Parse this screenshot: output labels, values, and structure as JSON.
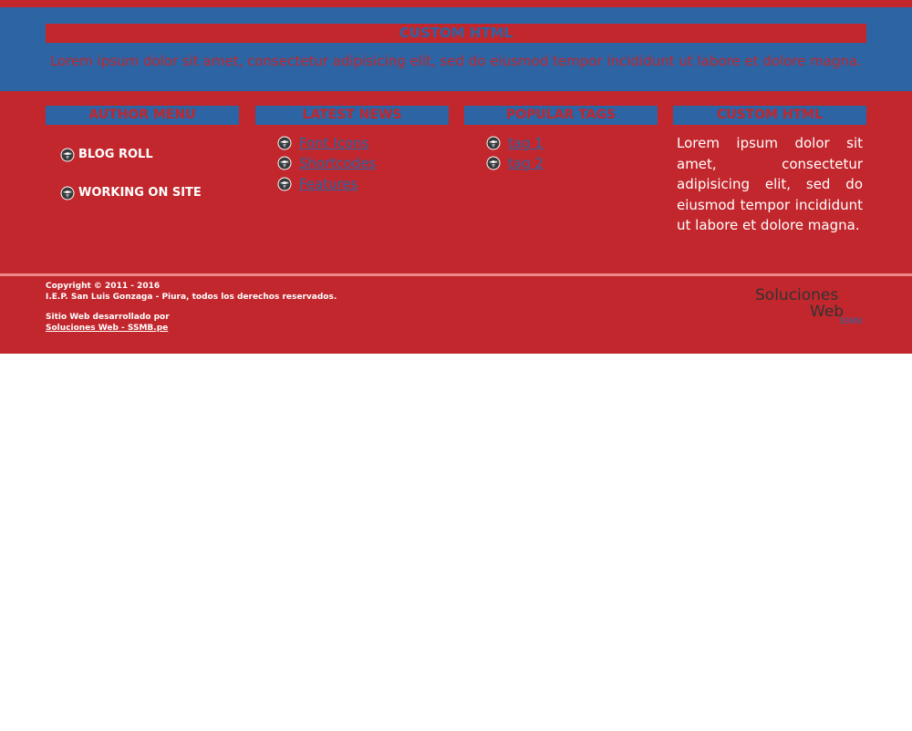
{
  "top": {
    "title": "CUSTOM HTML",
    "text": "Lorem ipsum dolor sit amet, consectetur adipisicing elit, sed do eiusmod tempor incididunt ut labore et dolore magna."
  },
  "columns": {
    "author_menu": {
      "title": "AUTHOR MENU",
      "items": [
        {
          "label": "BLOG ROLL"
        },
        {
          "label": "WORKING ON SITE"
        }
      ]
    },
    "latest_news": {
      "title": "LATEST NEWS",
      "items": [
        {
          "label": "Font Icons"
        },
        {
          "label": "Shortcodes"
        },
        {
          "label": "Features"
        }
      ]
    },
    "popular_tags": {
      "title": "POPULAR TAGS",
      "items": [
        {
          "label": "tag 1"
        },
        {
          "label": "tag 2"
        }
      ]
    },
    "custom_html": {
      "title": "CUSTOM HTML",
      "text": "Lorem ipsum dolor sit amet, consectetur adipisicing elit, sed do eiusmod tempor incididunt ut labore et dolore magna."
    }
  },
  "footer": {
    "copyright": "Copyright © 2011 - 2016",
    "school": "I.E.P. San Luis Gonzaga - Piura, todos los derechos reservados.",
    "developed_by": "Sitio Web desarrollado por",
    "developer_link": "Soluciones Web - SSMB.pe",
    "logo": {
      "line1": "Soluciones",
      "line2": "Web",
      "tag": "SSMB"
    }
  },
  "icons": {
    "bullet": "eagle-bullet-icon"
  },
  "colors": {
    "red": "#c1272d",
    "blue": "#2c64a4",
    "white": "#ffffff",
    "divider": "#ef8a8a"
  }
}
